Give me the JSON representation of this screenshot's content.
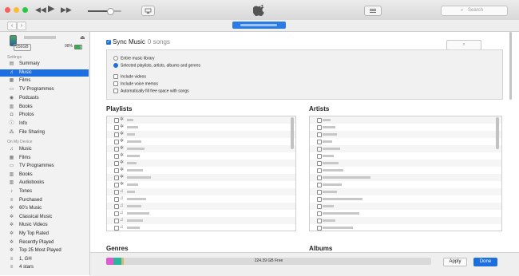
{
  "window": {
    "play_icon": "play-icon",
    "search_placeholder": "Search"
  },
  "nav": {
    "back": "‹",
    "forward": "›"
  },
  "device": {
    "capacity": "256GB",
    "battery": "98%"
  },
  "sidebar": {
    "settings_header": "Settings",
    "settings_items": [
      {
        "label": "Summary",
        "icon": "summary-icon",
        "glyph": "▤"
      },
      {
        "label": "Music",
        "icon": "music-note-icon",
        "glyph": "♫"
      },
      {
        "label": "Films",
        "icon": "film-icon",
        "glyph": "▦"
      },
      {
        "label": "TV Programmes",
        "icon": "tv-icon",
        "glyph": "▭"
      },
      {
        "label": "Podcasts",
        "icon": "podcast-icon",
        "glyph": "◉"
      },
      {
        "label": "Books",
        "icon": "book-icon",
        "glyph": "▥"
      },
      {
        "label": "Photos",
        "icon": "camera-icon",
        "glyph": "◘"
      },
      {
        "label": "Info",
        "icon": "info-icon",
        "glyph": "ⓘ"
      },
      {
        "label": "File Sharing",
        "icon": "file-sharing-icon",
        "glyph": "⁂"
      }
    ],
    "device_header": "On My Device",
    "device_items": [
      {
        "label": "Music",
        "icon": "music-note-icon",
        "glyph": "♫"
      },
      {
        "label": "Films",
        "icon": "film-icon",
        "glyph": "▦"
      },
      {
        "label": "TV Programmes",
        "icon": "tv-icon",
        "glyph": "▭"
      },
      {
        "label": "Books",
        "icon": "book-icon",
        "glyph": "▥"
      },
      {
        "label": "Audiobooks",
        "icon": "audiobook-icon",
        "glyph": "▥"
      },
      {
        "label": "Tones",
        "icon": "bell-icon",
        "glyph": "♪"
      },
      {
        "label": "Purchased",
        "icon": "playlist-icon",
        "glyph": "≡"
      },
      {
        "label": "60's Music",
        "icon": "gear-icon",
        "glyph": "✲"
      },
      {
        "label": "Classical Music",
        "icon": "gear-icon",
        "glyph": "✲"
      },
      {
        "label": "Music Videos",
        "icon": "gear-icon",
        "glyph": "✲"
      },
      {
        "label": "My Top Rated",
        "icon": "gear-icon",
        "glyph": "✲"
      },
      {
        "label": "Recently Played",
        "icon": "gear-icon",
        "glyph": "✲"
      },
      {
        "label": "Top 25 Most Played",
        "icon": "gear-icon",
        "glyph": "✲"
      },
      {
        "label": "1, GH",
        "icon": "playlist-icon",
        "glyph": "≡"
      },
      {
        "label": "4 stars",
        "icon": "playlist-icon",
        "glyph": "≡"
      }
    ]
  },
  "main": {
    "sync_label": "Sync Music",
    "sync_count": "0 songs",
    "options": {
      "entire_library": "Entire music library",
      "selected": "Selected playlists, artists, albums and genres",
      "include_videos": "Include videos",
      "include_voice_memos": "Include voice memos",
      "fill_free_space": "Automatically fill free space with songs"
    },
    "sections": {
      "playlists": "Playlists",
      "artists": "Artists",
      "genres": "Genres",
      "albums": "Albums"
    }
  },
  "bottom": {
    "free_space": "224.39 GB Free",
    "apply": "Apply",
    "done": "Done",
    "storage_segments": [
      {
        "name": "photos",
        "color": "#e05bd2",
        "fraction": 0.022
      },
      {
        "name": "apps",
        "color": "#2fb49b",
        "fraction": 0.025
      },
      {
        "name": "other",
        "color": "#7bd0e5",
        "fraction": 0.003
      },
      {
        "name": "documents",
        "color": "#f1b637",
        "fraction": 0.004
      }
    ]
  },
  "colors": {
    "accent": "#1d6fe0"
  }
}
